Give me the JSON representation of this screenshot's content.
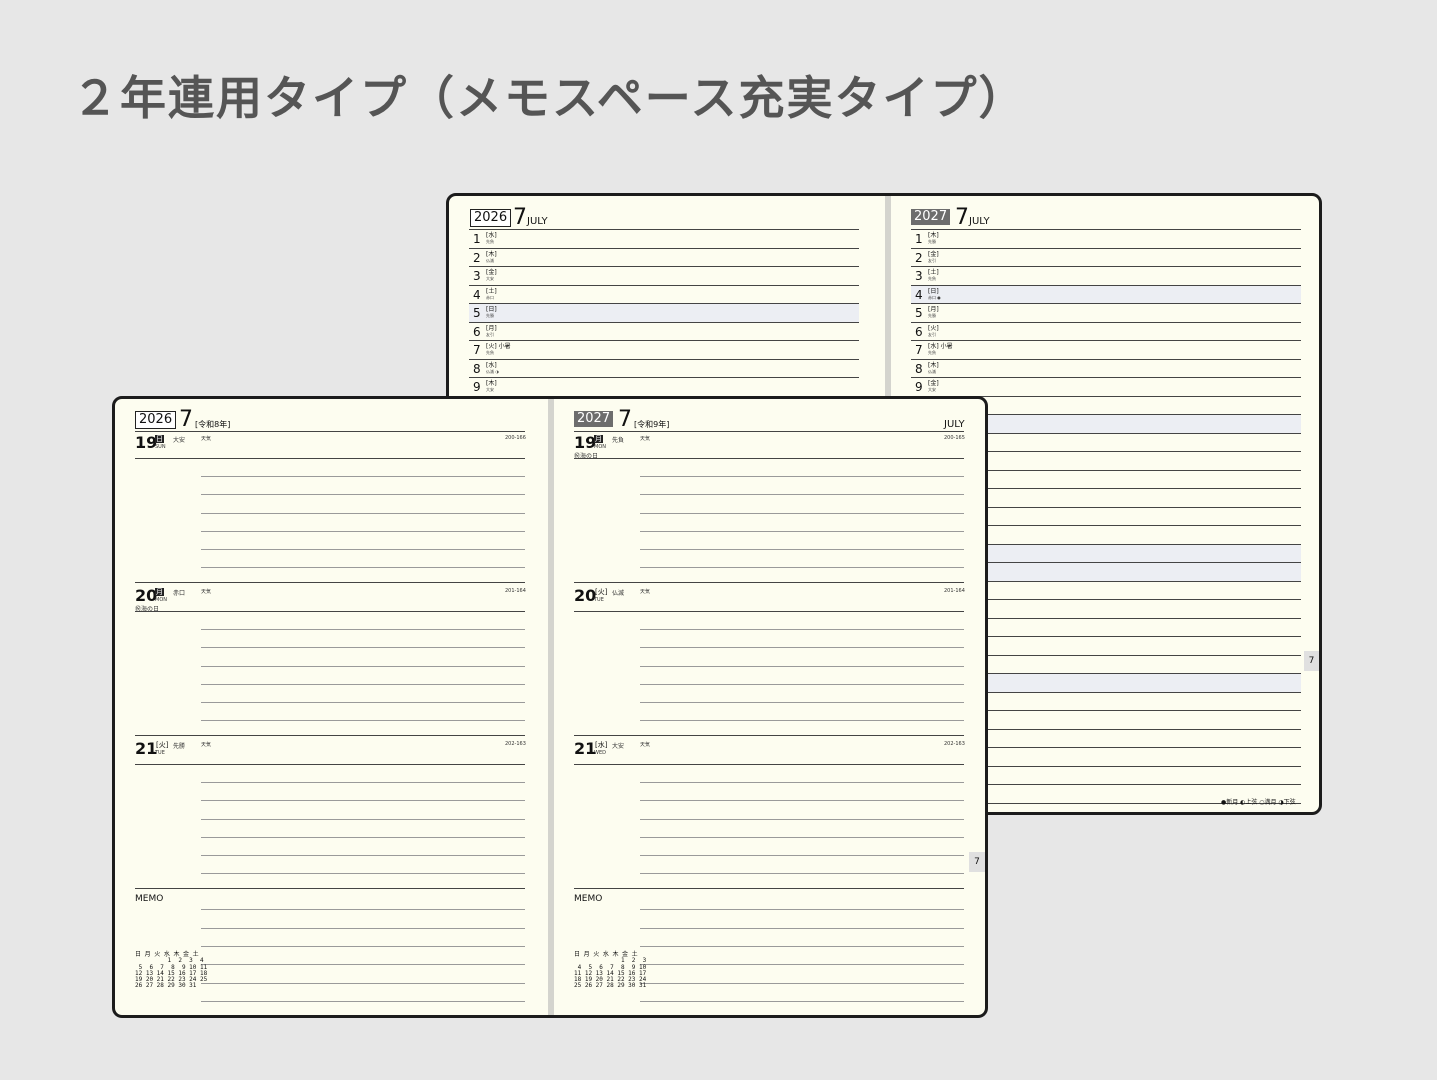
{
  "title": "２年連用タイプ（メモスペース充実タイプ）",
  "back": {
    "left": {
      "year": "2026",
      "month": "7",
      "month_en": "JULY",
      "rows": [
        {
          "d": "1",
          "dow": "[水]",
          "rk": "先負"
        },
        {
          "d": "2",
          "dow": "[木]",
          "rk": "仏滅"
        },
        {
          "d": "3",
          "dow": "[金]",
          "rk": "大安"
        },
        {
          "d": "4",
          "dow": "[土]",
          "rk": "赤口"
        },
        {
          "d": "5",
          "dow": "[日]",
          "rk": "先勝"
        },
        {
          "d": "6",
          "dow": "[月]",
          "rk": "友引"
        },
        {
          "d": "7",
          "dow": "[火] 小暑",
          "rk": "先負"
        },
        {
          "d": "8",
          "dow": "[水]",
          "rk": "仏滅 ◑"
        },
        {
          "d": "9",
          "dow": "[木]",
          "rk": "大安"
        }
      ]
    },
    "right": {
      "year": "2027",
      "month": "7",
      "month_en": "JULY",
      "rows": [
        {
          "d": "1",
          "dow": "[木]",
          "rk": "先勝"
        },
        {
          "d": "2",
          "dow": "[金]",
          "rk": "友引"
        },
        {
          "d": "3",
          "dow": "[土]",
          "rk": "先負"
        },
        {
          "d": "4",
          "dow": "[日]",
          "rk": "赤口 ●"
        },
        {
          "d": "5",
          "dow": "[月]",
          "rk": "先勝"
        },
        {
          "d": "6",
          "dow": "[火]",
          "rk": "友引"
        },
        {
          "d": "7",
          "dow": "[水] 小暑",
          "rk": "先負"
        },
        {
          "d": "8",
          "dow": "[木]",
          "rk": "仏滅"
        },
        {
          "d": "9",
          "dow": "[金]",
          "rk": "大安"
        }
      ],
      "tab": "7",
      "moon_legend": "●新月 ◐上弦 ○満月 ◑下弦"
    }
  },
  "front": {
    "left": {
      "year": "2026",
      "month": "7",
      "era": "[令和8年]",
      "days": [
        {
          "d": "19",
          "dow": "日",
          "en": "SUN",
          "rk": "大安",
          "weather": "天気",
          "count": "200-166",
          "holiday": ""
        },
        {
          "d": "20",
          "dow": "月",
          "en": "MON",
          "rk": "赤口",
          "weather": "天気",
          "count": "201-164",
          "holiday": "㊗海の日"
        },
        {
          "d": "21",
          "dow": "[火]",
          "en": "TUE",
          "rk": "先勝",
          "weather": "天気",
          "count": "202-163",
          "holiday": ""
        }
      ],
      "memo": "MEMO",
      "mini_cal": "日 月 火 水 木 金 土\n         1  2  3  4\n 5  6  7  8  9 10 11\n12 13 14 15 16 17 18\n19 20 21 22 23 24 25\n26 27 28 29 30 31"
    },
    "right": {
      "year": "2027",
      "month": "7",
      "era": "[令和9年]",
      "month_en": "JULY",
      "days": [
        {
          "d": "19",
          "dow": "月",
          "en": "MON",
          "rk": "先負",
          "weather": "天気",
          "count": "200-165",
          "holiday": "㊗海の日"
        },
        {
          "d": "20",
          "dow": "[火]",
          "en": "TUE",
          "rk": "仏滅",
          "weather": "天気",
          "count": "201-164",
          "holiday": ""
        },
        {
          "d": "21",
          "dow": "[水]",
          "en": "WED",
          "rk": "大安",
          "weather": "天気",
          "count": "202-163",
          "holiday": ""
        }
      ],
      "memo": "MEMO",
      "tab": "7",
      "mini_cal": "日 月 火 水 木 金 土\n             1  2  3\n 4  5  6  7  8  9 10\n11 12 13 14 15 16 17\n18 19 20 21 22 23 24\n25 26 27 28 29 30 31"
    }
  }
}
